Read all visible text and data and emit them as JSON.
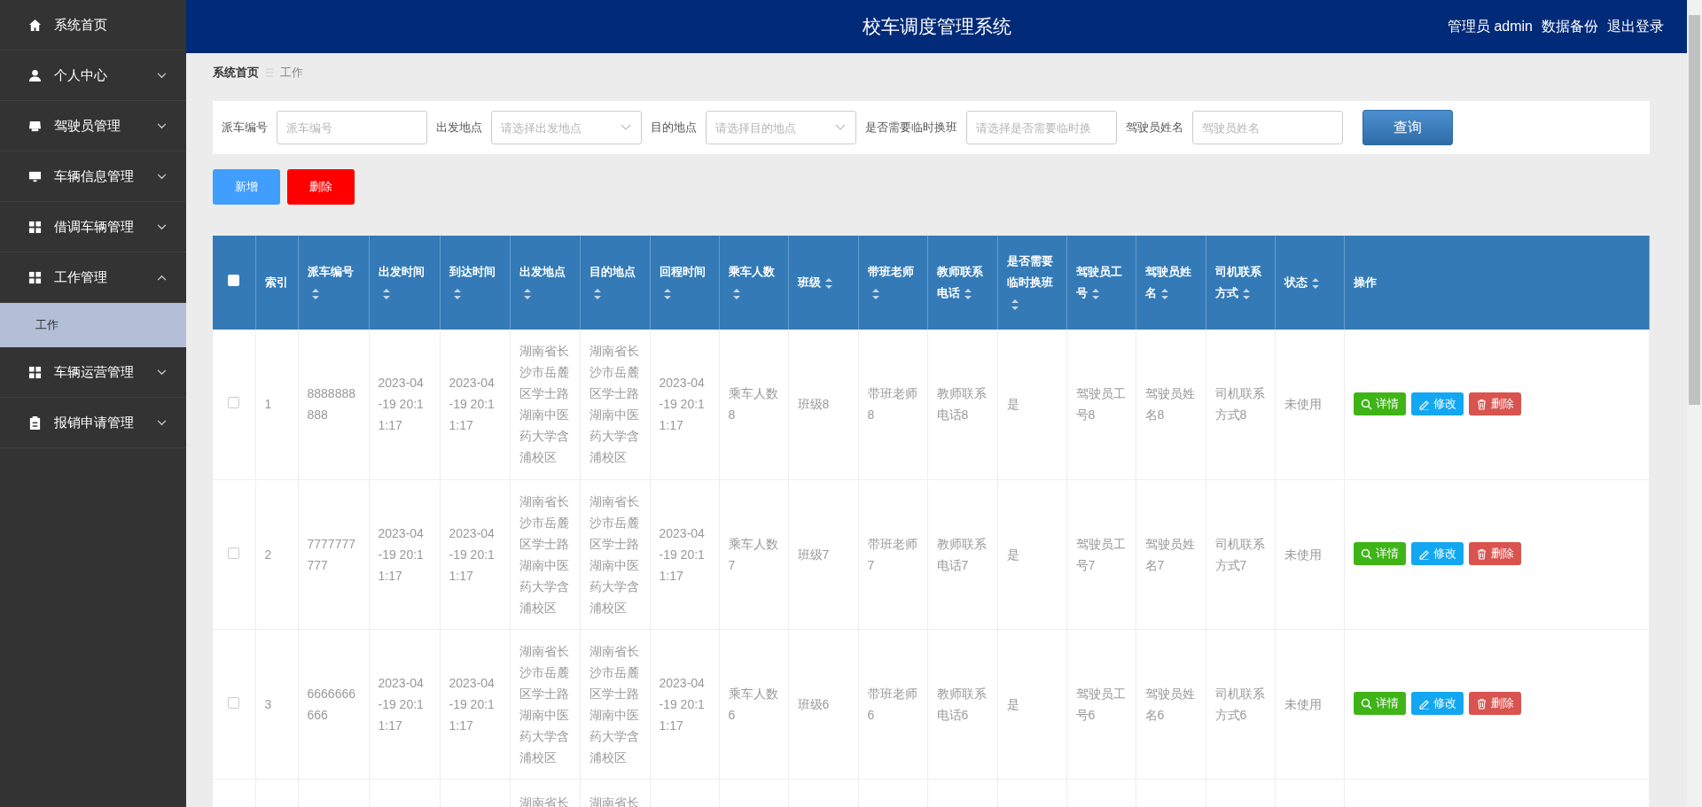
{
  "header": {
    "title": "校车调度管理系统",
    "links": [
      "管理员 admin",
      "数据备份",
      "退出登录"
    ]
  },
  "sidebar": {
    "items": [
      {
        "label": "系统首页",
        "kind": "link"
      },
      {
        "label": "个人中心",
        "kind": "menu",
        "expanded": false
      },
      {
        "label": "驾驶员管理",
        "kind": "menu",
        "expanded": false
      },
      {
        "label": "车辆信息管理",
        "kind": "menu",
        "expanded": false
      },
      {
        "label": "借调车辆管理",
        "kind": "menu",
        "expanded": false
      },
      {
        "label": "工作管理",
        "kind": "menu",
        "expanded": true,
        "children": [
          {
            "label": "工作",
            "selected": true
          }
        ]
      },
      {
        "label": "车辆运营管理",
        "kind": "menu",
        "expanded": false
      },
      {
        "label": "报销申请管理",
        "kind": "menu",
        "expanded": false
      }
    ]
  },
  "breadcrumb": [
    "系统首页",
    "工作"
  ],
  "filters": [
    {
      "label": "派车编号",
      "kind": "text",
      "placeholder": "派车编号"
    },
    {
      "label": "出发地点",
      "kind": "select",
      "placeholder": "请选择出发地点"
    },
    {
      "label": "目的地点",
      "kind": "select",
      "placeholder": "请选择目的地点"
    },
    {
      "label": "是否需要临时换班",
      "kind": "text",
      "placeholder": "请选择是否需要临时换"
    },
    {
      "label": "驾驶员姓名",
      "kind": "text",
      "placeholder": "驾驶员姓名"
    }
  ],
  "search_button": "查询",
  "actions": [
    {
      "label": "新增",
      "kind": "add"
    },
    {
      "label": "删除",
      "kind": "delete"
    }
  ],
  "table": {
    "select_all": {
      "checked": false
    },
    "columns": [
      {
        "label": "索引",
        "sortable": false
      },
      {
        "label": "派车编号",
        "sortable": true
      },
      {
        "label": "出发时间",
        "sortable": true
      },
      {
        "label": "到达时间",
        "sortable": true
      },
      {
        "label": "出发地点",
        "sortable": true
      },
      {
        "label": "目的地点",
        "sortable": true
      },
      {
        "label": "回程时间",
        "sortable": true
      },
      {
        "label": "乘车人数",
        "sortable": true
      },
      {
        "label": "班级",
        "sortable": true
      },
      {
        "label": "带班老师",
        "sortable": true
      },
      {
        "label": "教师联系电话",
        "sortable": true
      },
      {
        "label": "是否需要临时换班",
        "sortable": true
      },
      {
        "label": "驾驶员工号",
        "sortable": true
      },
      {
        "label": "驾驶员姓名",
        "sortable": true
      },
      {
        "label": "司机联系方式",
        "sortable": true
      },
      {
        "label": "状态",
        "sortable": true
      },
      {
        "label": "操作",
        "sortable": false
      }
    ],
    "rows": [
      {
        "kind": "full",
        "checked": false,
        "cells": [
          "1",
          "8888888888",
          "2023-04-19 20:11:17",
          "2023-04-19 20:11:17",
          "湖南省长沙市岳麓区学士路湖南中医药大学含浦校区",
          "湖南省长沙市岳麓区学士路湖南中医药大学含浦校区",
          "2023-04-19 20:11:17",
          "乘车人数8",
          "班级8",
          "带班老师8",
          "教师联系电话8",
          "是",
          "驾驶员工号8",
          "驾驶员姓名8",
          "司机联系方式8",
          "未使用"
        ],
        "buttons": [
          {
            "label": "详情",
            "kind": "view"
          },
          {
            "label": "修改",
            "kind": "edit"
          },
          {
            "label": "删除",
            "kind": "delete"
          }
        ]
      },
      {
        "kind": "full",
        "checked": false,
        "cells": [
          "2",
          "7777777777",
          "2023-04-19 20:11:17",
          "2023-04-19 20:11:17",
          "湖南省长沙市岳麓区学士路湖南中医药大学含浦校区",
          "湖南省长沙市岳麓区学士路湖南中医药大学含浦校区",
          "2023-04-19 20:11:17",
          "乘车人数7",
          "班级7",
          "带班老师7",
          "教师联系电话7",
          "是",
          "驾驶员工号7",
          "驾驶员姓名7",
          "司机联系方式7",
          "未使用"
        ],
        "buttons": [
          {
            "label": "详情",
            "kind": "view"
          },
          {
            "label": "修改",
            "kind": "edit"
          },
          {
            "label": "删除",
            "kind": "delete"
          }
        ]
      },
      {
        "kind": "full",
        "checked": false,
        "cells": [
          "3",
          "6666666666",
          "2023-04-19 20:11:17",
          "2023-04-19 20:11:17",
          "湖南省长沙市岳麓区学士路湖南中医药大学含浦校区",
          "湖南省长沙市岳麓区学士路湖南中医药大学含浦校区",
          "2023-04-19 20:11:17",
          "乘车人数6",
          "班级6",
          "带班老师6",
          "教师联系电话6",
          "是",
          "驾驶员工号6",
          "驾驶员姓名6",
          "司机联系方式6",
          "未使用"
        ],
        "buttons": [
          {
            "label": "详情",
            "kind": "view"
          },
          {
            "label": "修改",
            "kind": "edit"
          },
          {
            "label": "删除",
            "kind": "delete"
          }
        ]
      },
      {
        "kind": "partial",
        "cells": [
          null,
          null,
          null,
          null,
          "湖南省长",
          "湖南省长",
          null,
          null,
          null,
          null,
          null,
          null,
          null,
          null,
          null,
          null
        ]
      }
    ]
  }
}
